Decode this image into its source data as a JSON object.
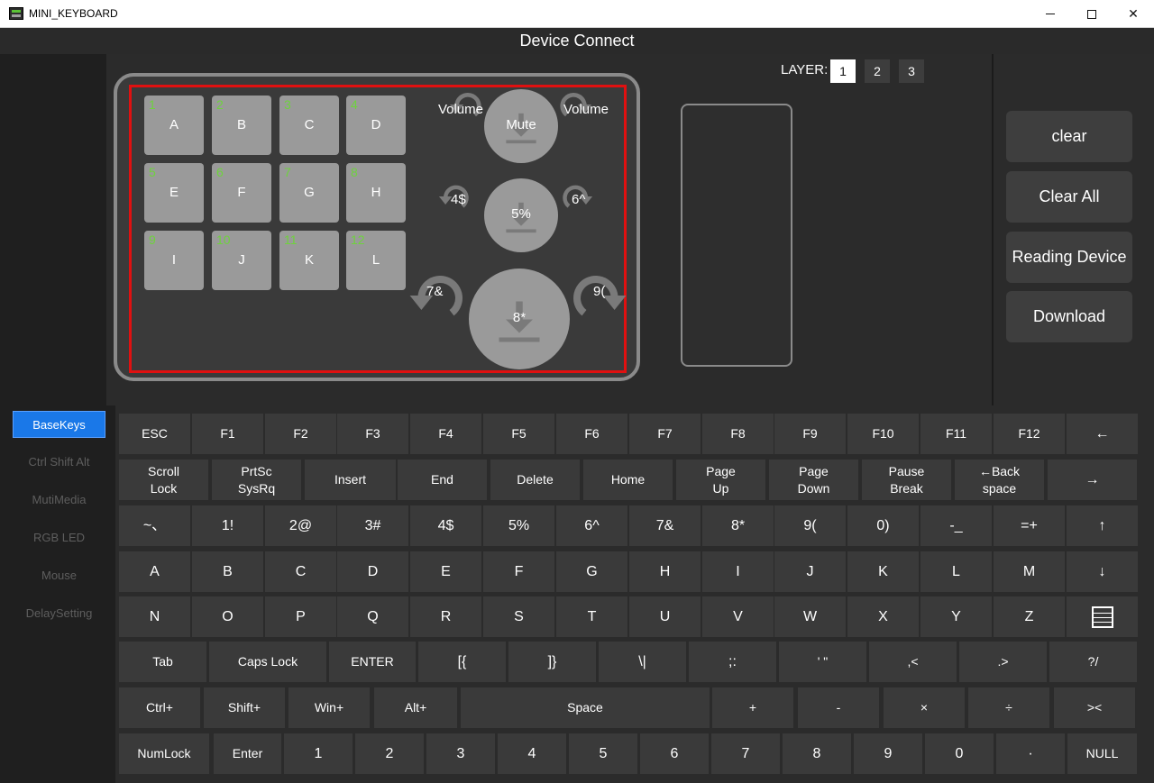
{
  "window": {
    "title": "MINI_KEYBOARD",
    "minimize": "",
    "maximize": "",
    "close": "✕"
  },
  "header": {
    "title": "Device Connect"
  },
  "layer": {
    "label": "LAYER:",
    "buttons": [
      "1",
      "2",
      "3"
    ],
    "active": "1"
  },
  "device": {
    "keys": [
      {
        "num": "1",
        "label": "A"
      },
      {
        "num": "2",
        "label": "B"
      },
      {
        "num": "3",
        "label": "C"
      },
      {
        "num": "4",
        "label": "D"
      },
      {
        "num": "5",
        "label": "E"
      },
      {
        "num": "6",
        "label": "F"
      },
      {
        "num": "7",
        "label": "G"
      },
      {
        "num": "8",
        "label": "H"
      },
      {
        "num": "9",
        "label": "I"
      },
      {
        "num": "10",
        "label": "J"
      },
      {
        "num": "11",
        "label": "K"
      },
      {
        "num": "12",
        "label": "L"
      }
    ],
    "knobs": [
      {
        "center": "Mute",
        "left": "Volume",
        "right": "Volume"
      },
      {
        "center": "5%",
        "left": "4$",
        "right": "6^"
      },
      {
        "center": "8*",
        "left": "7&",
        "right": "9("
      }
    ]
  },
  "actions": {
    "clear": "clear",
    "clear_all": "Clear All",
    "reading": "Reading Device",
    "download": "Download"
  },
  "sidebar": {
    "items": [
      "BaseKeys",
      "Ctrl Shift Alt",
      "MutiMedia",
      "RGB LED",
      "Mouse",
      "DelaySetting"
    ],
    "active": "BaseKeys"
  },
  "keyboard": {
    "row1": [
      "ESC",
      "F1",
      "F2",
      "F3",
      "F4",
      "F5",
      "F6",
      "F7",
      "F8",
      "F9",
      "F10",
      "F11",
      "F12",
      "←"
    ],
    "row2": [
      "Scroll\nLock",
      "PrtSc\nSysRq",
      "Insert",
      "End",
      "Delete",
      "Home",
      "Page\nUp",
      "Page\nDown",
      "Pause\nBreak",
      "←Back\nspace",
      "→"
    ],
    "row3": [
      "~、",
      "1!",
      "2@",
      "3#",
      "4$",
      "5%",
      "6^",
      "7&",
      "8*",
      "9(",
      "0)",
      "-_",
      "=+",
      "↑"
    ],
    "row4": [
      "A",
      "B",
      "C",
      "D",
      "E",
      "F",
      "G",
      "H",
      "I",
      "J",
      "K",
      "L",
      "M",
      "↓"
    ],
    "row5": [
      "N",
      "O",
      "P",
      "Q",
      "R",
      "S",
      "T",
      "U",
      "V",
      "W",
      "X",
      "Y",
      "Z",
      "menu-icon"
    ],
    "row6": [
      "Tab",
      "Caps Lock",
      "ENTER",
      "[{",
      "]}",
      "\\|",
      ";:",
      "' \"",
      ",<",
      ".>",
      "?/"
    ],
    "row7": [
      "Ctrl+",
      "Shift+",
      "Win+",
      "Alt+",
      "Space",
      "+",
      "-",
      "×",
      "÷",
      "><"
    ],
    "row8": [
      "NumLock",
      "Enter",
      "1",
      "2",
      "3",
      "4",
      "5",
      "6",
      "7",
      "8",
      "9",
      "0",
      "·",
      "NULL"
    ]
  }
}
